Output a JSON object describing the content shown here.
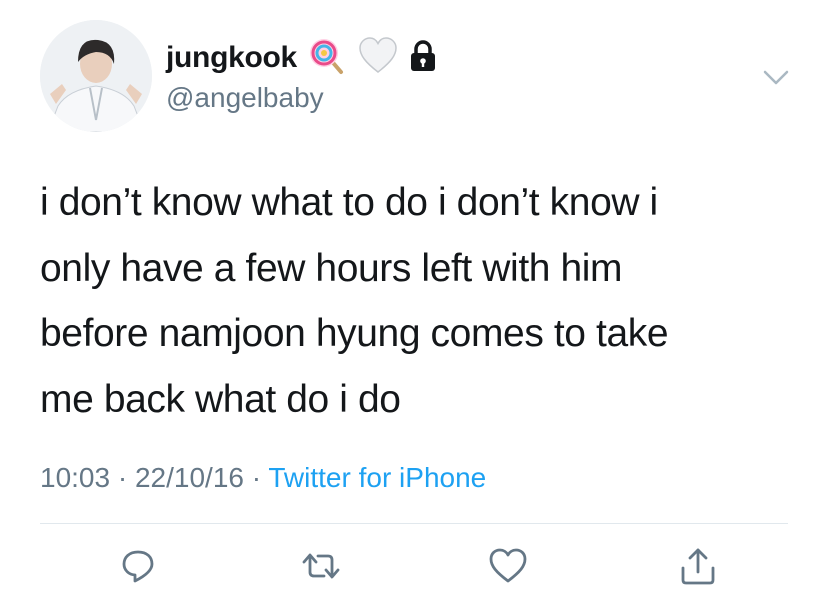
{
  "tweet": {
    "author": {
      "display_name": "jungkook",
      "handle": "@angelbaby",
      "badges": [
        "lollipop-emoji",
        "white-heart-emoji",
        "lock-icon"
      ]
    },
    "text_lines": [
      "i don’t know what to do i don’t know i",
      "only have a few hours left with him",
      "before namjoon hyung comes to take",
      "me back what do i do"
    ],
    "time": "10:03",
    "date": "22/10/16",
    "separator": "·",
    "source": "Twitter for iPhone"
  },
  "actions": [
    "reply-icon",
    "retweet-icon",
    "like-icon",
    "share-icon"
  ],
  "colors": {
    "text": "#14171a",
    "muted": "#657786",
    "link": "#1da1f2",
    "divider": "#e1e8ed"
  }
}
